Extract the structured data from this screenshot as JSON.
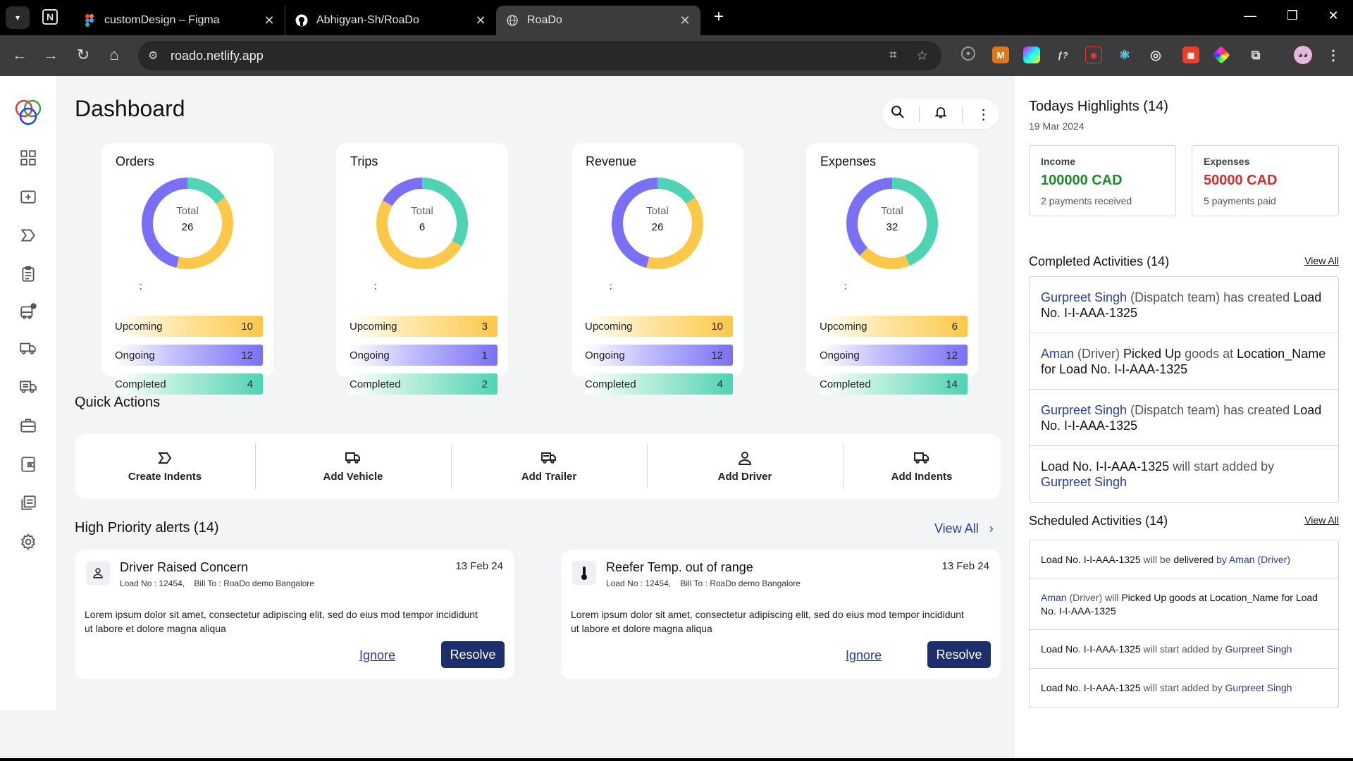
{
  "browser": {
    "tabs": [
      {
        "title": "customDesign – Figma"
      },
      {
        "title": "Abhigyan-Sh/RoaDo"
      },
      {
        "title": "RoaDo"
      }
    ],
    "url": "roado.netlify.app"
  },
  "page": {
    "title": "Dashboard"
  },
  "stats": [
    {
      "title": "Orders",
      "total_label": "Total",
      "total": "26",
      "semicolon": ";",
      "upcoming_label": "Upcoming",
      "upcoming": "10",
      "ongoing_label": "Ongoing",
      "ongoing": "12",
      "completed_label": "Completed",
      "completed": "4"
    },
    {
      "title": "Trips",
      "total_label": "Total",
      "total": "6",
      "semicolon": ";",
      "upcoming_label": "Upcoming",
      "upcoming": "3",
      "ongoing_label": "Ongoing",
      "ongoing": "1",
      "completed_label": "Completed",
      "completed": "2"
    },
    {
      "title": "Revenue",
      "total_label": "Total",
      "total": "26",
      "semicolon": ";",
      "upcoming_label": "Upcoming",
      "upcoming": "10",
      "ongoing_label": "Ongoing",
      "ongoing": "12",
      "completed_label": "Completed",
      "completed": "4"
    },
    {
      "title": "Expenses",
      "total_label": "Total",
      "total": "32",
      "semicolon": ";",
      "upcoming_label": "Upcoming",
      "upcoming": "6",
      "ongoing_label": "Ongoing",
      "ongoing": "12",
      "completed_label": "Completed",
      "completed": "14"
    }
  ],
  "colors": {
    "upcoming": "#fcc84a",
    "ongoing": "#7a70f5",
    "completed": "#4fd3b5",
    "income": "#1e8a2e",
    "expense": "#d32f2f",
    "accent": "#1d2f6b"
  },
  "quick_actions": {
    "title": "Quick Actions",
    "items": [
      {
        "label": "Create Indents",
        "icon": "indent-icon"
      },
      {
        "label": "Add Vehicle",
        "icon": "truck-icon"
      },
      {
        "label": "Add Trailer",
        "icon": "trailer-icon"
      },
      {
        "label": "Add Driver",
        "icon": "user-icon"
      },
      {
        "label": "Add Indents",
        "icon": "truck-icon"
      }
    ]
  },
  "alerts": {
    "title": "High Priority alerts (14)",
    "view_all": "View All",
    "items": [
      {
        "title": "Driver Raised Concern",
        "meta": "Load No : 12454,    Bill To : RoaDo demo Bangalore",
        "date": "13 Feb 24",
        "body": "Lorem ipsum dolor sit amet, consectetur adipiscing elit, sed do eius mod tempor incididunt ut labore et dolore magna aliqua",
        "ignore": "Ignore",
        "resolve": "Resolve",
        "icon": "user-icon"
      },
      {
        "title": "Reefer Temp. out of range",
        "meta": "Load No : 12454,    Bill To : RoaDo demo Bangalore",
        "date": "13 Feb 24",
        "body": "Lorem ipsum dolor sit amet, consectetur adipiscing elit, sed do eius mod tempor incididunt ut labore et dolore magna aliqua",
        "ignore": "Ignore",
        "resolve": "Resolve",
        "icon": "thermometer-icon"
      }
    ]
  },
  "highlights": {
    "title": "Todays Highlights (14)",
    "date": "19 Mar 2024",
    "income": {
      "label": "Income",
      "value": "100000 CAD",
      "sub": "2 payments received"
    },
    "expenses": {
      "label": "Expenses",
      "value": "50000 CAD",
      "sub": "5 payments paid"
    }
  },
  "completed": {
    "title": "Completed Activities (14)",
    "view_all": "View All",
    "items": [
      {
        "a": "Gurpreet Singh",
        "b": " (Dispatch team) ",
        "c": "has created ",
        "d": "Load No. I-I-AAA-1325",
        "e": ""
      },
      {
        "a": "Aman",
        "b": " (Driver) ",
        "c": "Picked Up ",
        "d": "goods at ",
        "e": "Location_Name for Load No. I-I-AAA-1325"
      },
      {
        "a": "Gurpreet Singh",
        "b": " (Dispatch team) ",
        "c": "has created ",
        "d": "Load No. I-I-AAA-1325",
        "e": ""
      },
      {
        "a": "Load No. I-I-AAA-1325",
        "b": " will start added by ",
        "c": "Gurpreet Singh",
        "d": "",
        "e": ""
      }
    ]
  },
  "scheduled": {
    "title": "Scheduled Activities (14)",
    "view_all": "View All",
    "items": [
      {
        "a": "Load No. I-I-AAA-1325",
        "b": " will be ",
        "c": "delivered",
        "d": " by Aman (Driver)"
      },
      {
        "a": "Aman",
        "b": " (Driver) will ",
        "c": "Picked Up",
        "d": " goods at Location_Name for Load No. I-I-AAA-1325"
      },
      {
        "a": "Load No. I-I-AAA-1325",
        "b": " will start added by ",
        "c": "Gurpreet Singh",
        "d": ""
      },
      {
        "a": "Load No. I-I-AAA-1325",
        "b": " will start added by ",
        "c": "Gurpreet Singh",
        "d": ""
      }
    ]
  }
}
